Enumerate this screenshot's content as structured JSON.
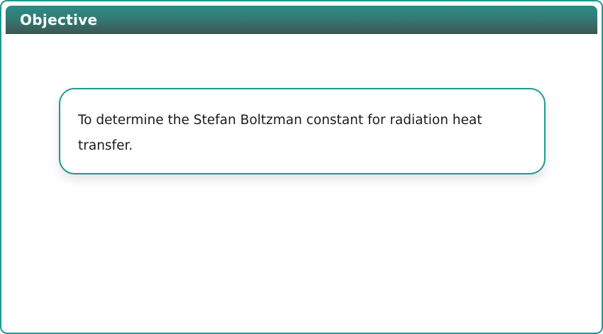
{
  "header": {
    "title": "Objective"
  },
  "objective": {
    "text": "To determine the Stefan Boltzman constant for radiation heat transfer."
  },
  "colors": {
    "accent": "#1f9994",
    "header_gradient_top": "#2b8c86",
    "header_gradient_bottom": "#3d5652",
    "text": "#1b1b1b",
    "background": "#ffffff"
  }
}
